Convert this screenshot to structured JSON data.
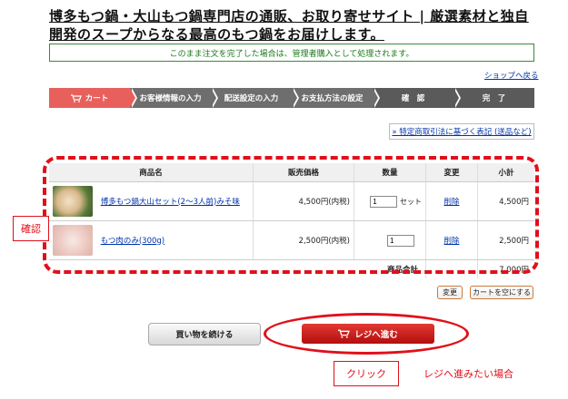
{
  "header": {
    "title": "博多もつ鍋・大山もつ鍋専門店の通販、お取り寄せサイト | 厳選素材と独自開発のスープからなる最高のもつ鍋をお届けします。",
    "notice": "このまま注文を完了した場合は、管理者購入として処理されます。",
    "shop_link": "ショップへ戻る"
  },
  "steps": [
    {
      "label": "カート"
    },
    {
      "label": "お客様情報の入力"
    },
    {
      "label": "配送設定の入力"
    },
    {
      "label": "お支払方法の設定"
    },
    {
      "label": "確　認"
    },
    {
      "label": "完　了"
    }
  ],
  "law_link": "» 特定商取引法に基づく表記 (送品など)",
  "table": {
    "headers": {
      "name": "商品名",
      "price": "販売価格",
      "qty": "数量",
      "change": "変更",
      "subtotal": "小計"
    },
    "rows": [
      {
        "name": "博多もつ鍋大山セット(2〜3人前)みそ味",
        "price": "4,500円(内税)",
        "qty": "1",
        "qty_unit": "セット",
        "change": "削除",
        "subtotal": "4,500円"
      },
      {
        "name": "もつ肉のみ(300g)",
        "price": "2,500円(内税)",
        "qty": "1",
        "qty_unit": "",
        "change": "削除",
        "subtotal": "2,500円"
      }
    ],
    "total_label": "商品合計",
    "total_value": "7,000円"
  },
  "buttons": {
    "update": "変更",
    "empty": "カートを空にする",
    "continue": "買い物を続ける",
    "checkout": "レジへ進む"
  },
  "annotations": {
    "confirm": "確認",
    "click": "クリック",
    "checkout_note": "レジへ進みたい場合"
  },
  "colors": {
    "accent": "#e0101a",
    "active_step": "#e8605c",
    "notice_green": "#1a7a1a"
  }
}
